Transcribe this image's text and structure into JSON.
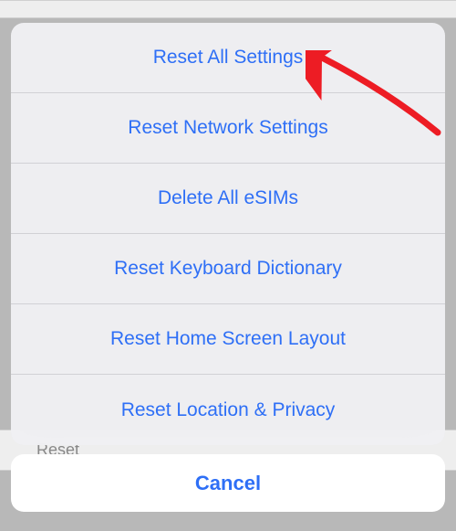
{
  "background": {
    "partial_label": "Reset"
  },
  "sheet": {
    "items": [
      {
        "label": "Reset All Settings"
      },
      {
        "label": "Reset Network Settings"
      },
      {
        "label": "Delete All eSIMs"
      },
      {
        "label": "Reset Keyboard Dictionary"
      },
      {
        "label": "Reset Home Screen Layout"
      },
      {
        "label": "Reset Location & Privacy"
      }
    ],
    "cancel_label": "Cancel"
  },
  "annotation": {
    "arrow_color": "#ed1c24",
    "points_to": "Reset All Settings"
  }
}
